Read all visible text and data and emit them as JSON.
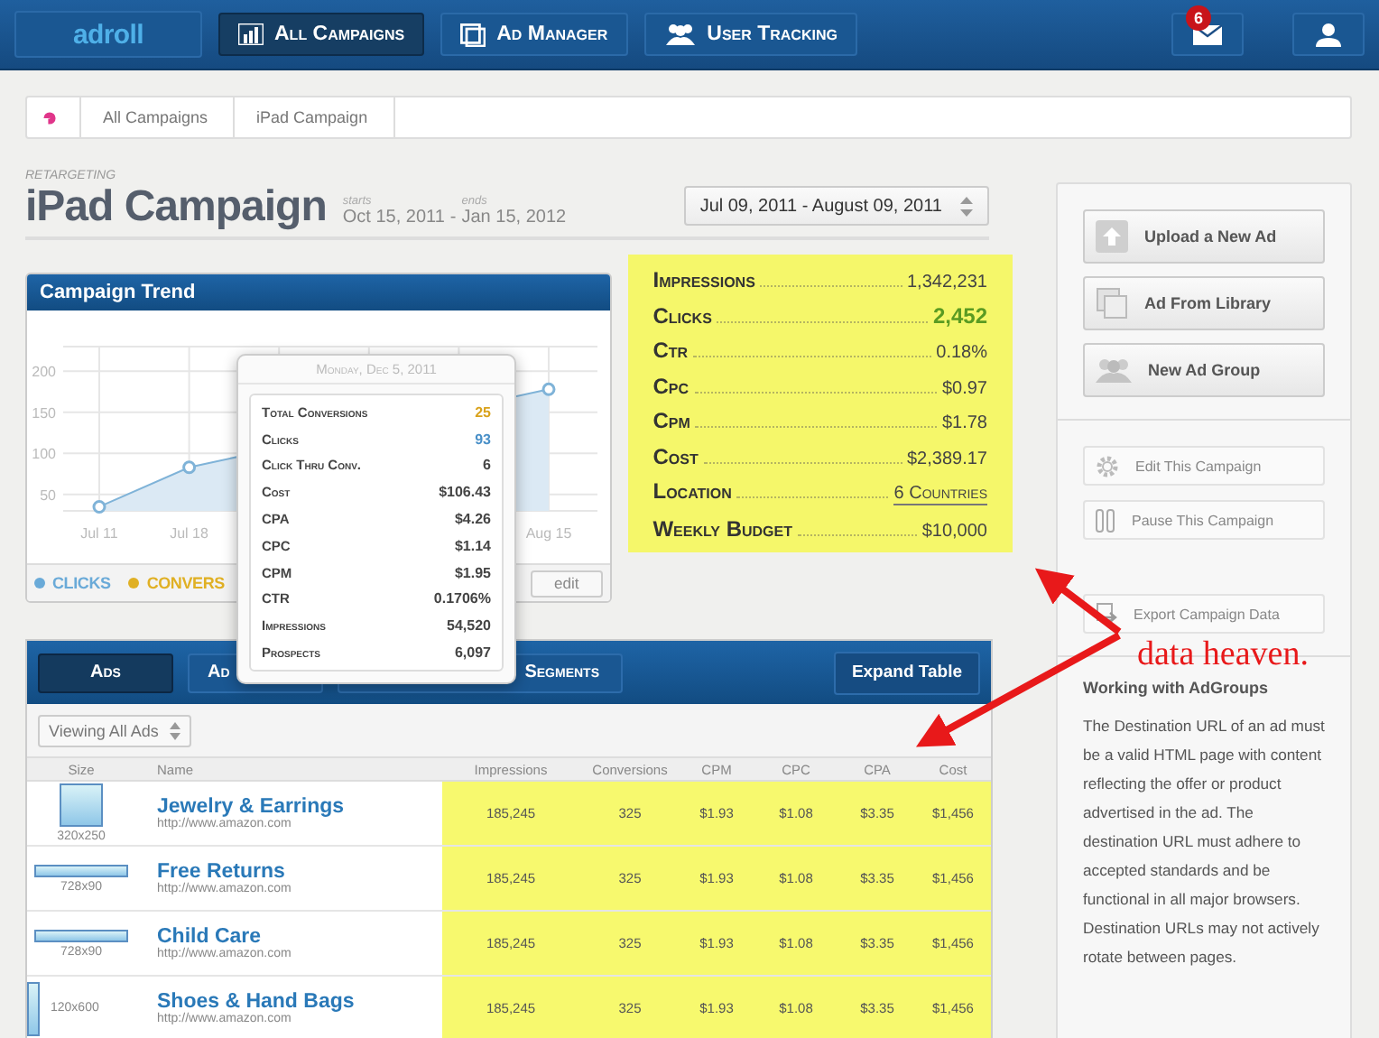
{
  "nav": {
    "logo": "adroll",
    "items": [
      {
        "label": "All Campaigns",
        "selected": true
      },
      {
        "label": "Ad Manager",
        "selected": false
      },
      {
        "label": "User Tracking",
        "selected": false
      }
    ],
    "mail_badge": "6"
  },
  "breadcrumb": [
    "All Campaigns",
    "iPad Campaign"
  ],
  "campaign": {
    "type": "RETARGETING",
    "title": "iPad Campaign",
    "start_label": "starts",
    "start_date": "Oct 15, 2011",
    "separator": "-",
    "end_label": "ends",
    "end_date": "Jan 15, 2012",
    "date_range": "Jul 09, 2011 - August 09, 2011"
  },
  "trend": {
    "title": "Campaign Trend",
    "chart_data": {
      "type": "area",
      "categories": [
        "Jul 11",
        "Jul 18",
        null,
        null,
        null,
        "Aug 15"
      ],
      "ylim": [
        30,
        230
      ],
      "grid": true,
      "yticks": [
        50,
        100,
        150,
        200
      ],
      "series": [
        {
          "color": "#7fb3d8",
          "values": [
            35,
            83,
            null,
            null,
            null,
            178
          ]
        }
      ]
    },
    "legend": [
      {
        "label": "CLICKS",
        "color": "#6aaad8"
      },
      {
        "label": "CONVERS",
        "color": "#e0b024"
      }
    ],
    "edit_button": "edit",
    "tooltip": {
      "date": "Monday, Dec 5, 2011",
      "rows": [
        {
          "label": "Total Conversions",
          "value": "25",
          "color": "#d9a21b"
        },
        {
          "label": "Clicks",
          "value": "93",
          "color": "#4a90c8"
        },
        {
          "label": "Click Thru Conv.",
          "value": "6",
          "color": "#444444"
        },
        {
          "label": "Cost",
          "value": "$106.43",
          "color": "#444444"
        },
        {
          "label": "CPA",
          "value": "$4.26",
          "color": "#444444"
        },
        {
          "label": "CPC",
          "value": "$1.14",
          "color": "#444444"
        },
        {
          "label": "CPM",
          "value": "$1.95",
          "color": "#444444"
        },
        {
          "label": "CTR",
          "value": "0.1706%",
          "color": "#444444"
        },
        {
          "label": "Impressions",
          "value": "54,520",
          "color": "#444444"
        },
        {
          "label": "Prospects",
          "value": "6,097",
          "color": "#444444"
        }
      ]
    }
  },
  "stats": [
    {
      "label": "Impressions",
      "value": "1,342,231",
      "kind": "plain"
    },
    {
      "label": "Clicks",
      "value": "2,452",
      "kind": "highlight"
    },
    {
      "label": "Ctr",
      "value": "0.18%",
      "kind": "plain"
    },
    {
      "label": "Cpc",
      "value": "$0.97",
      "kind": "plain"
    },
    {
      "label": "Cpm",
      "value": "$1.78",
      "kind": "plain"
    },
    {
      "label": "Cost",
      "value": "$2,389.17",
      "kind": "plain"
    },
    {
      "label": "Location",
      "value": "6 Countries",
      "kind": "link"
    },
    {
      "label": "Weekly Budget",
      "value": "$10,000",
      "kind": "plain"
    }
  ],
  "ads": {
    "tabs": [
      {
        "label": "Ads",
        "selected": true
      },
      {
        "label": "Ad",
        "selected": false
      },
      {
        "label": "Segments",
        "selected": false
      }
    ],
    "expand_button": "Expand Table",
    "filter": "Viewing All Ads",
    "columns": [
      "Size",
      "Name",
      "Impressions",
      "Conversions",
      "CPM",
      "CPC",
      "CPA",
      "Cost"
    ],
    "rows": [
      {
        "size": "320x250",
        "name": "Jewelry & Earrings",
        "url": "http://www.amazon.com",
        "values": [
          "185,245",
          "325",
          "$1.93",
          "$1.08",
          "$3.35",
          "$1,456"
        ]
      },
      {
        "size": "728x90",
        "name": "Free Returns",
        "url": "http://www.amazon.com",
        "values": [
          "185,245",
          "325",
          "$1.93",
          "$1.08",
          "$3.35",
          "$1,456"
        ]
      },
      {
        "size": "728x90",
        "name": "Child Care",
        "url": "http://www.amazon.com",
        "values": [
          "185,245",
          "325",
          "$1.93",
          "$1.08",
          "$3.35",
          "$1,456"
        ]
      },
      {
        "size": "120x600",
        "name": "Shoes & Hand Bags",
        "url": "http://www.amazon.com",
        "values": [
          "185,245",
          "325",
          "$1.93",
          "$1.08",
          "$3.35",
          "$1,456"
        ]
      }
    ]
  },
  "sidebar": {
    "actions": [
      {
        "label": "Upload a New Ad",
        "kind": "primary"
      },
      {
        "label": "Ad From Library",
        "kind": "primary"
      },
      {
        "label": "New Ad Group",
        "kind": "primary"
      },
      {
        "label": "Edit This Campaign",
        "kind": "secondary"
      },
      {
        "label": "Pause This Campaign",
        "kind": "secondary"
      },
      {
        "label": "Export Campaign Data",
        "kind": "secondary"
      }
    ],
    "help_title": "Working with AdGroups",
    "help_text": "The Destination URL of an ad must be a valid HTML page with content reflecting the offer or product advertised in the ad. The destination URL must adhere to accepted standards and be functional in all major browsers. Destination URLs may not actively rotate between pages."
  },
  "annotation": "data heaven."
}
